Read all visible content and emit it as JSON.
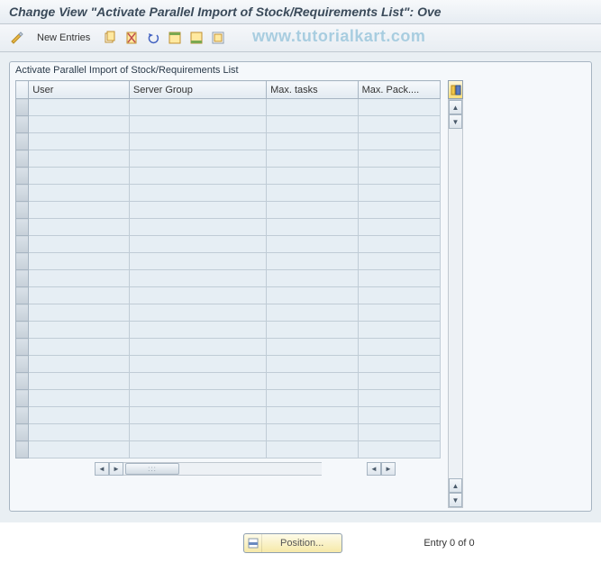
{
  "title": "Change View \"Activate Parallel Import of Stock/Requirements List\": Ove",
  "watermark": "www.tutorialkart.com",
  "toolbar": {
    "new_entries": "New Entries"
  },
  "panel": {
    "header": "Activate Parallel Import of Stock/Requirements List",
    "columns": [
      "User",
      "Server Group",
      "Max. tasks",
      "Max. Pack...."
    ],
    "rows": [
      [
        "",
        "",
        "",
        ""
      ],
      [
        "",
        "",
        "",
        ""
      ],
      [
        "",
        "",
        "",
        ""
      ],
      [
        "",
        "",
        "",
        ""
      ],
      [
        "",
        "",
        "",
        ""
      ],
      [
        "",
        "",
        "",
        ""
      ],
      [
        "",
        "",
        "",
        ""
      ],
      [
        "",
        "",
        "",
        ""
      ],
      [
        "",
        "",
        "",
        ""
      ],
      [
        "",
        "",
        "",
        ""
      ],
      [
        "",
        "",
        "",
        ""
      ],
      [
        "",
        "",
        "",
        ""
      ],
      [
        "",
        "",
        "",
        ""
      ],
      [
        "",
        "",
        "",
        ""
      ],
      [
        "",
        "",
        "",
        ""
      ],
      [
        "",
        "",
        "",
        ""
      ],
      [
        "",
        "",
        "",
        ""
      ],
      [
        "",
        "",
        "",
        ""
      ],
      [
        "",
        "",
        "",
        ""
      ],
      [
        "",
        "",
        "",
        ""
      ],
      [
        "",
        "",
        "",
        ""
      ]
    ]
  },
  "footer": {
    "position_label": "Position...",
    "entry_label": "Entry 0 of 0"
  }
}
